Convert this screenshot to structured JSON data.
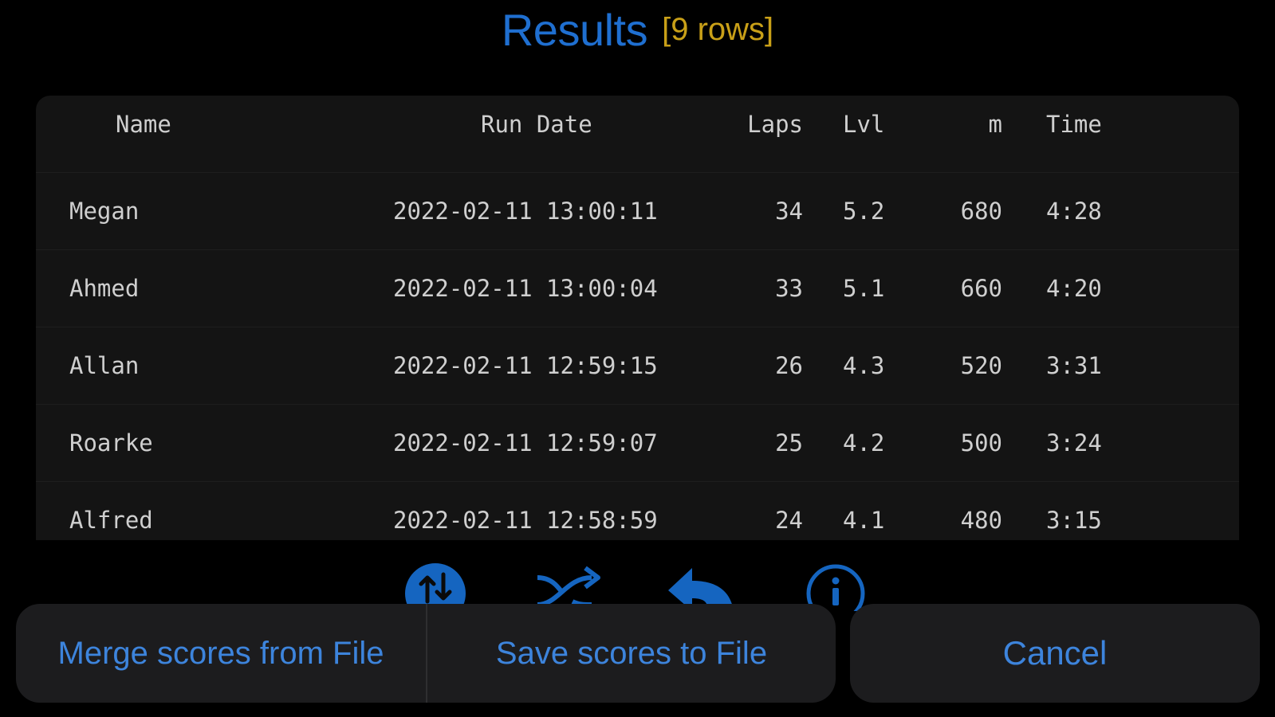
{
  "header": {
    "title": "Results",
    "row_count": "[9 rows]"
  },
  "table": {
    "columns": {
      "name": "Name",
      "run_date": "Run Date",
      "laps": "Laps",
      "lvl": "Lvl",
      "m": "m",
      "time": "Time"
    },
    "rows": [
      {
        "name": "Megan",
        "run_date": "2022-02-11 13:00:11",
        "laps": "34",
        "lvl": "5.2",
        "m": "680",
        "time": "4:28"
      },
      {
        "name": "Ahmed",
        "run_date": "2022-02-11 13:00:04",
        "laps": "33",
        "lvl": "5.1",
        "m": "660",
        "time": "4:20"
      },
      {
        "name": "Allan",
        "run_date": "2022-02-11 12:59:15",
        "laps": "26",
        "lvl": "4.3",
        "m": "520",
        "time": "3:31"
      },
      {
        "name": "Roarke",
        "run_date": "2022-02-11 12:59:07",
        "laps": "25",
        "lvl": "4.2",
        "m": "500",
        "time": "3:24"
      },
      {
        "name": "Alfred",
        "run_date": "2022-02-11 12:58:59",
        "laps": "24",
        "lvl": "4.1",
        "m": "480",
        "time": "3:15"
      }
    ]
  },
  "toolbar": {
    "icons": [
      "sort-icon",
      "shuffle-icon",
      "undo-icon",
      "info-icon"
    ]
  },
  "action_sheet": {
    "merge_label": "Merge scores from File",
    "save_label": "Save scores to File",
    "cancel_label": "Cancel"
  },
  "colors": {
    "title": "#1f6fd0",
    "row_count": "#c9a018",
    "accent": "#3d84dc",
    "panel": "#141414",
    "sheet": "#1c1c1e"
  }
}
